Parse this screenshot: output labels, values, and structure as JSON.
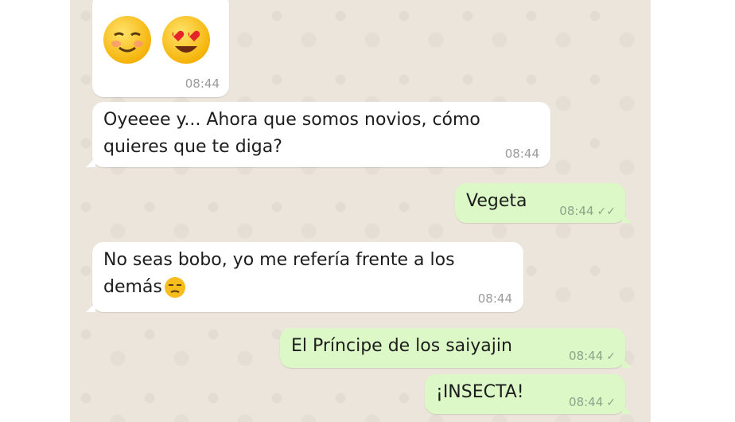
{
  "messages": [
    {
      "type": "emoji",
      "direction": "incoming",
      "icons": [
        "smiling-blush-icon",
        "heart-eyes-icon"
      ],
      "time": "08:44"
    },
    {
      "type": "text",
      "direction": "incoming",
      "lines": [
        "Oyeeee y... Ahora que somos novios, cómo",
        "quieres que te diga?"
      ],
      "time": "08:44"
    },
    {
      "type": "text",
      "direction": "outgoing",
      "lines": [
        "Vegeta"
      ],
      "time": "08:44",
      "status": "read"
    },
    {
      "type": "text",
      "direction": "incoming",
      "lines": [
        "No seas bobo, yo me refería frente a los",
        "demás"
      ],
      "trailing_icon": "unamused-face-icon",
      "time": "08:44"
    },
    {
      "type": "text",
      "direction": "outgoing",
      "lines": [
        "El Príncipe de los saiyajin"
      ],
      "time": "08:44",
      "status": "sent"
    },
    {
      "type": "text",
      "direction": "outgoing",
      "lines": [
        "¡INSECTA!"
      ],
      "time": "08:44",
      "status": "sent"
    }
  ],
  "colors": {
    "incoming": "#ffffff",
    "outgoing": "#dcf8c6",
    "wallpaper": "#ece5dc"
  }
}
